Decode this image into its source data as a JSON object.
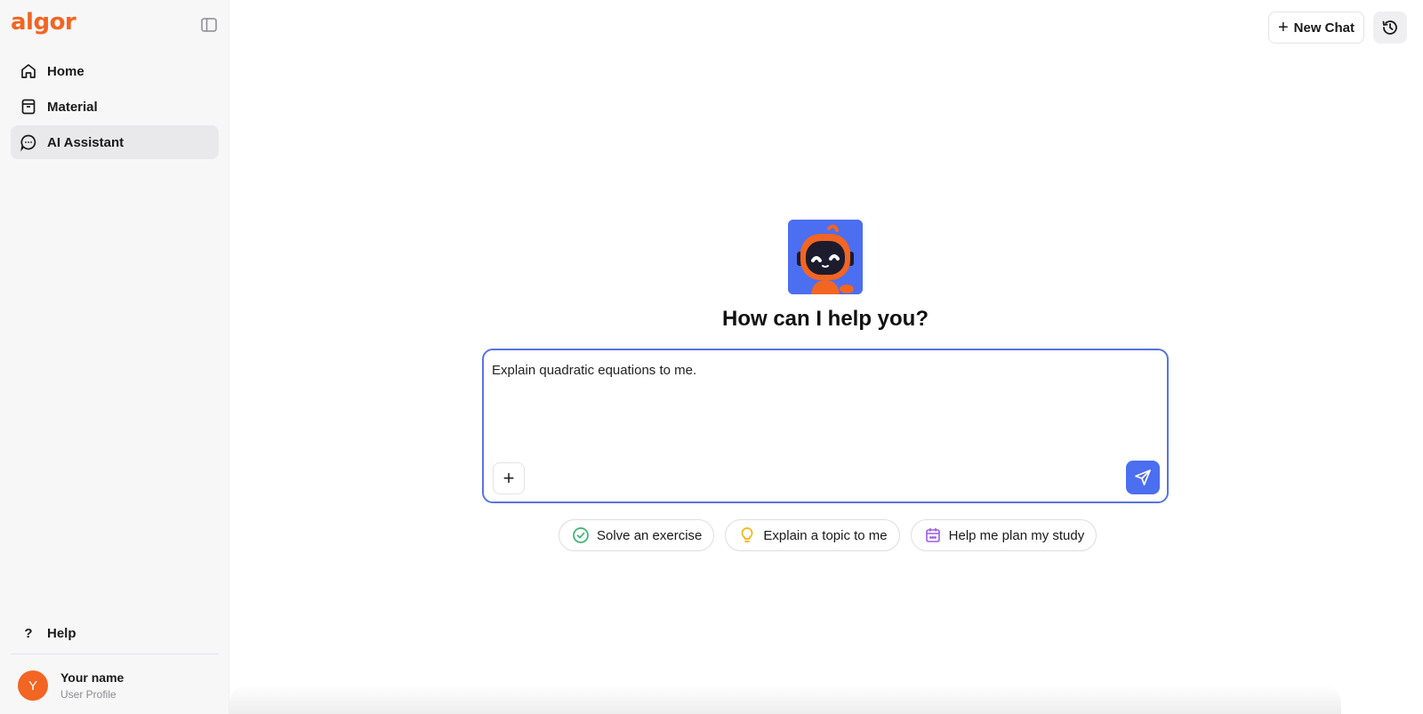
{
  "sidebar": {
    "logo": "algor",
    "items": [
      {
        "label": "Home",
        "icon": "home-icon"
      },
      {
        "label": "Material",
        "icon": "archive-box-icon"
      },
      {
        "label": "AI Assistant",
        "icon": "chat-bubble-icon",
        "active": true
      }
    ],
    "help_label": "Help",
    "profile": {
      "initial": "Y",
      "name": "Your name",
      "subtitle": "User Profile"
    }
  },
  "header": {
    "new_chat_label": "New Chat",
    "history_icon": "history-icon"
  },
  "main": {
    "headline": "How can I help you?",
    "input_text": "Explain quadratic equations to me.",
    "suggestions": [
      {
        "label": "Solve an exercise",
        "icon": "check-circle-icon",
        "color": "#3cb371"
      },
      {
        "label": "Explain a topic to me",
        "icon": "lightbulb-icon",
        "color": "#f5b400"
      },
      {
        "label": "Help me plan my study",
        "icon": "calendar-icon",
        "color": "#9b5de5"
      }
    ]
  },
  "colors": {
    "brand": "#f26522",
    "accent": "#4c6ef0"
  }
}
